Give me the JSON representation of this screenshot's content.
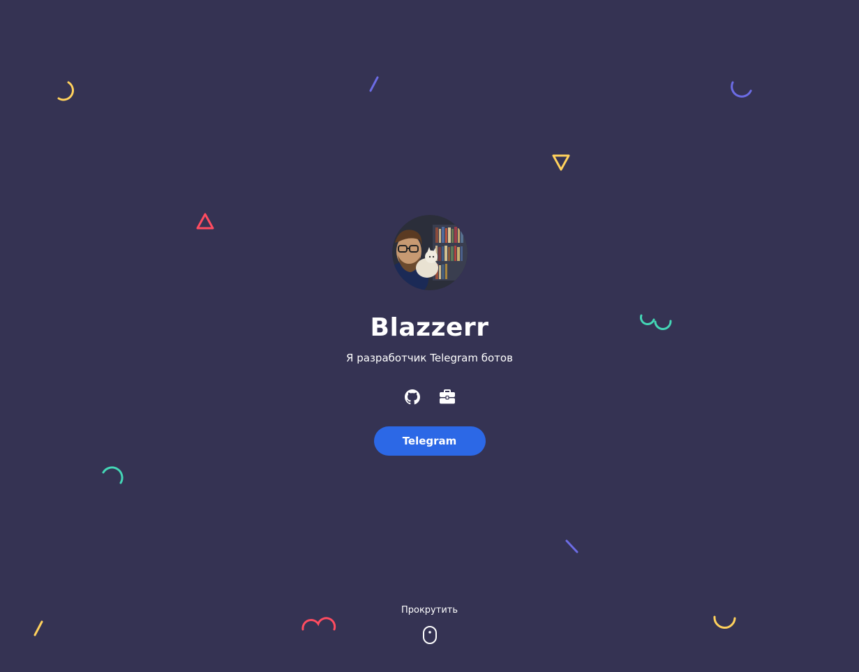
{
  "profile": {
    "name": "Blazzerr",
    "subtitle": "Я разработчик Telegram ботов",
    "avatar_alt": "Blazzerr avatar"
  },
  "socials": [
    {
      "icon": "github-icon"
    },
    {
      "icon": "briefcase-icon"
    }
  ],
  "cta": {
    "label": "Telegram"
  },
  "scroll": {
    "label": "Прокрутить",
    "icon": "mouse-icon"
  },
  "colors": {
    "background": "#353353",
    "accent_blue": "#2c68e6",
    "yellow": "#ffd15c",
    "purple": "#6c6ce5",
    "red": "#ff4c60",
    "teal": "#44d7b6"
  }
}
